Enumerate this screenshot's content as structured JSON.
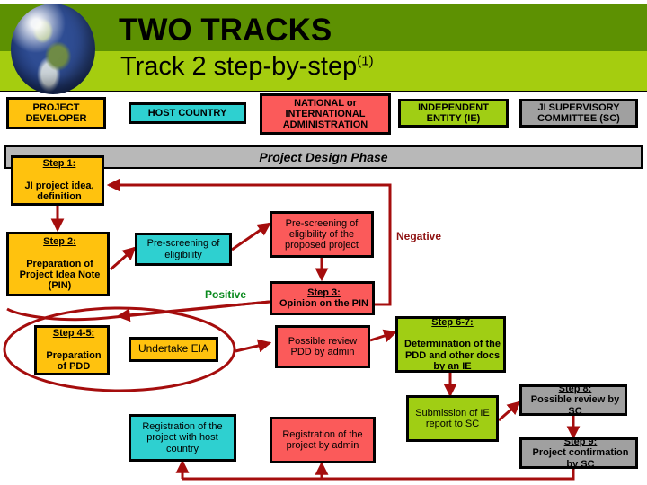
{
  "header": {
    "title": "TWO TRACKS",
    "subtitle": "Track 2 step-by-step",
    "subtitle_sup": "(1)",
    "globe_icon": "earth-globe-icon",
    "band_dark_color": "#5d9102",
    "band_light_color": "#a5cd0f"
  },
  "columns": [
    {
      "label": "PROJECT DEVELOPER",
      "color": "#ffc20e"
    },
    {
      "label": "HOST COUNTRY",
      "color": "#2ed0d0"
    },
    {
      "label": "NATIONAL or INTERNATIONAL ADMINISTRATION",
      "color": "#fb5a5a"
    },
    {
      "label": "INDEPENDENT ENTITY (IE)",
      "color": "#a0ce14"
    },
    {
      "label": "JI SUPERVISORY COMMITTEE (SC)",
      "color": "#a0a0a0"
    }
  ],
  "phase": {
    "label": "Project Design Phase",
    "color": "#b8b8b8"
  },
  "nodes": {
    "step1": {
      "heading": "Step 1:",
      "body": "JI project idea, definition",
      "color": "#ffc20e"
    },
    "step2": {
      "heading": "Step 2:",
      "body": "Preparation of Project Idea Note (PIN)",
      "color": "#ffc20e"
    },
    "step45": {
      "heading": "Step 4-5:",
      "body": "Preparation of PDD",
      "color": "#ffc20e"
    },
    "undertake_eia": {
      "heading": "",
      "body": "Undertake EIA",
      "color": "#ffc20e"
    },
    "prescreen": {
      "heading": "",
      "body": "Pre-screening of eligibility",
      "color": "#2ed0d0"
    },
    "reg_host": {
      "heading": "",
      "body": "Registration of the project with host country",
      "color": "#2ed0d0"
    },
    "prescreen_adm": {
      "heading": "",
      "body": "Pre-screening of eligibility of the proposed project",
      "color": "#fb5a5a"
    },
    "step3": {
      "heading": "Step 3:",
      "body": "Opinion on the PIN",
      "color": "#fb5a5a"
    },
    "review_pdd": {
      "heading": "",
      "body": "Possible review PDD by admin",
      "color": "#fb5a5a"
    },
    "reg_admin": {
      "heading": "",
      "body": "Registration of the project by admin",
      "color": "#fb5a5a"
    },
    "step67": {
      "heading": "Step 6-7:",
      "body": "Determination of the PDD and other docs by an IE",
      "color": "#a0ce14"
    },
    "submission": {
      "heading": "",
      "body": "Submission of IE report to SC",
      "color": "#a0ce14"
    },
    "step8": {
      "heading": "Step 8:",
      "body": "Possible review by SC",
      "color": "#a0a0a0"
    },
    "step9": {
      "heading": "Step 9:",
      "body": "Project confirmation by SC",
      "color": "#a0a0a0"
    }
  },
  "edge_labels": {
    "positive": "Positive",
    "negative": "Negative",
    "positive_color": "#0a8a1e",
    "negative_color": "#8e1111"
  },
  "connector_color": "#a50d0d",
  "highlight_ellipse_color": "#a50d0d"
}
